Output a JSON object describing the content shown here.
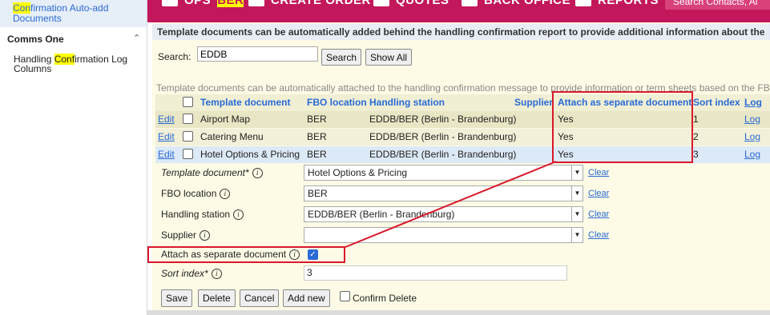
{
  "sidebar": {
    "top_link_pre": "",
    "top_link_hl": "Con",
    "top_link_post": "firmation Auto-add Documents",
    "section_title": "Comms One",
    "item_pre": "Handling ",
    "item_hl": "Conf",
    "item_post": "irmation Log Columns"
  },
  "topbar": {
    "items": [
      "OPS",
      "BER",
      "CREATE ORDER",
      "QUOTES",
      "BACK OFFICE",
      "REPORTS"
    ],
    "search_placeholder": "Search Contacts, Ai"
  },
  "banner": "Template documents can be automatically added behind the handling confirmation report to provide additional information about the",
  "search": {
    "label": "Search:",
    "value": "EDDB",
    "search_button": "Search",
    "show_all_button": "Show All"
  },
  "info_text": "Template documents can be automatically attached to the handling confirmation message to provide information or term sheets based on the FB",
  "grid": {
    "headers": {
      "template": "Template document",
      "fbo": "FBO location",
      "station": "Handling station",
      "supplier": "Supplier",
      "attach": "Attach as separate document",
      "sort": "Sort index",
      "log": "Log"
    },
    "rows": [
      {
        "edit": "Edit",
        "template": "Airport Map",
        "fbo": "BER",
        "station": "EDDB/BER (Berlin - Brandenburg)",
        "attach": "Yes",
        "sort": "1",
        "log": "Log"
      },
      {
        "edit": "Edit",
        "template": "Catering Menu",
        "fbo": "BER",
        "station": "EDDB/BER (Berlin - Brandenburg)",
        "attach": "Yes",
        "sort": "2",
        "log": "Log"
      },
      {
        "edit": "Edit",
        "template": "Hotel Options & Pricing",
        "fbo": "BER",
        "station": "EDDB/BER (Berlin - Brandenburg)",
        "attach": "Yes",
        "sort": "3",
        "log": "Log"
      }
    ]
  },
  "form": {
    "template_label": "Template document*",
    "template_value": "Hotel Options & Pricing",
    "fbo_label": "FBO location",
    "fbo_value": "BER",
    "station_label": "Handling station",
    "station_value": "EDDB/BER (Berlin - Brandenburg)",
    "supplier_label": "Supplier",
    "supplier_value": "",
    "attach_label": "Attach as separate document",
    "attach_checked": true,
    "sort_label": "Sort index*",
    "sort_value": "3",
    "clear_label": "Clear",
    "save": "Save",
    "delete": "Delete",
    "cancel": "Cancel",
    "add_new": "Add new",
    "confirm_delete": "Confirm Delete"
  },
  "colors": {
    "topbar": "#c2185b",
    "link": "#2a6ad4",
    "annotation": "#d9182a",
    "highlight": "#ffff00"
  }
}
